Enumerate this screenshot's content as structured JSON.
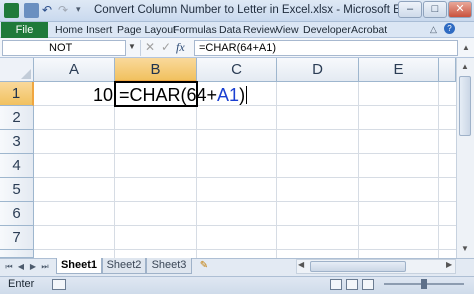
{
  "window": {
    "title": "Convert Column Number to Letter in Excel.xlsx - Microsoft Excel",
    "controls": {
      "minimize": "–",
      "maximize": "□",
      "close": "✕"
    }
  },
  "ribbon": {
    "file_label": "File",
    "tabs": [
      "Home",
      "Insert",
      "Page Layout",
      "Formulas",
      "Data",
      "Review",
      "View",
      "Developer",
      "Acrobat"
    ]
  },
  "formula_bar": {
    "name_box": "NOT",
    "cancel_icon": "✕",
    "enter_icon": "✓",
    "fx_label": "fx",
    "formula": "=CHAR(64+A1)"
  },
  "grid": {
    "columns": [
      "A",
      "B",
      "C",
      "D",
      "E"
    ],
    "rows": [
      "1",
      "2",
      "3",
      "4",
      "5",
      "6",
      "7"
    ],
    "active_column": "B",
    "active_row": "1",
    "cells": {
      "A1": "10",
      "B1_prefix": "=CHAR(64+",
      "B1_ref": "A1",
      "B1_suffix": ")"
    }
  },
  "sheets": {
    "tabs": [
      "Sheet1",
      "Sheet2",
      "Sheet3"
    ],
    "active": "Sheet1"
  },
  "status": {
    "mode": "Enter"
  },
  "colors": {
    "file_tab": "#1f7a3a",
    "active_header": "#f1c15f",
    "cell_reference": "#1a3fd1"
  }
}
